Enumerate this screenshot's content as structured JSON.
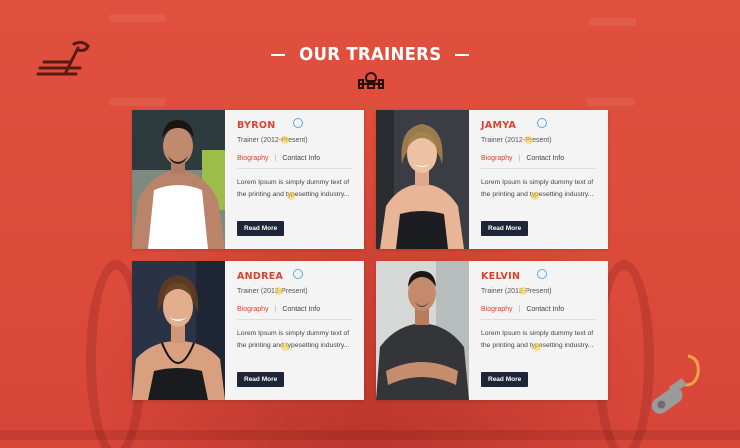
{
  "section": {
    "title": "OUR TRAINERS"
  },
  "trainers": [
    {
      "name": "BYRON",
      "role": "Trainer (2012-Present)",
      "bio_label": "Biography",
      "sep": "|",
      "contact_label": "Contact Info",
      "description": "Lorem Ipsum is simply dummy text of the printing and typesetting industry...",
      "button_label": "Read More"
    },
    {
      "name": "JAMYA",
      "role": "Trainer (2012-Present)",
      "bio_label": "Biography",
      "sep": "|",
      "contact_label": "Contact Info",
      "description": "Lorem Ipsum is simply dummy text of the printing and typesetting industry...",
      "button_label": "Read More"
    },
    {
      "name": "ANDREA",
      "role": "Trainer (2012-Present)",
      "bio_label": "Biography",
      "sep": "|",
      "contact_label": "Contact Info",
      "description": "Lorem Ipsum is simply dummy text of the printing and typesetting industry...",
      "button_label": "Read More"
    },
    {
      "name": "KELVIN",
      "role": "Trainer (2012-Present)",
      "bio_label": "Biography",
      "sep": "|",
      "contact_label": "Contact Info",
      "description": "Lorem Ipsum is simply dummy text of the printing and typesetting industry...",
      "button_label": "Read More"
    }
  ],
  "colors": {
    "background": "#de4c3c",
    "accent": "#d9432f",
    "button": "#1d2536",
    "card": "#f4f4f4"
  },
  "icons": {
    "title_decoration": "dumbbell-icon",
    "corner_left": "treadmill-icon",
    "corner_right": "whistle-icon"
  }
}
